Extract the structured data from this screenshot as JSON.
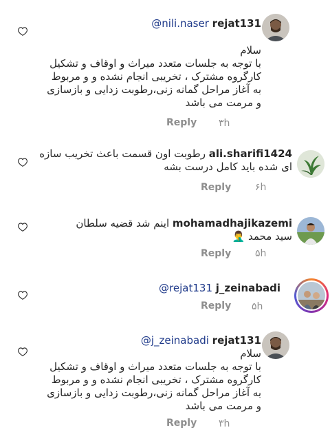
{
  "comments": [
    {
      "username": "rejat131",
      "mention": "@nili.naser",
      "lines": [
        "سلام",
        "با توجه به جلسات متعدد میراث و اوقاف و تشکیل",
        "کارگروه مشترک ، تخریبی انجام نشده و و مربوط",
        "به آغاز مراحل گمانه زنی،رطوبت زدایی و بازسازی",
        "و مرمت می باشد"
      ],
      "time": "۳h",
      "reply_label": "Reply"
    },
    {
      "username": "ali.sharifi1424",
      "lines": [
        "رطوبت اون قسمت باعث تخریب سازه",
        "ای شده باید کامل درست بشه"
      ],
      "time": "۶h",
      "reply_label": "Reply"
    },
    {
      "username": "mohamadhajikazemi",
      "lines": [
        "اینم شد قضیه سلطان",
        "سید محمد 🤦‍♂️"
      ],
      "time": "۵h",
      "reply_label": "Reply"
    },
    {
      "username": "j_zeinabadi",
      "mention": "@rejat131",
      "lines": [],
      "time": "۵h",
      "reply_label": "Reply"
    },
    {
      "username": "rejat131",
      "mention": "@j_zeinabadi",
      "lines": [
        "سلام",
        "با توجه به جلسات متعدد میراث و اوقاف و تشکیل",
        "کارگروه مشترک ، تخریبی انجام نشده و و مربوط",
        "به آغاز مراحل گمانه زنی،رطوبت زدایی و بازسازی",
        "و مرمت می باشد"
      ],
      "time": "۳h",
      "reply_label": "Reply"
    }
  ],
  "colors": {
    "mention": "#1f3a8a",
    "meta": "#8e8e8e",
    "story_ring_start": "#f58529",
    "story_ring_end": "#515bd4"
  },
  "icons": {
    "like": "heart-outline-icon"
  }
}
